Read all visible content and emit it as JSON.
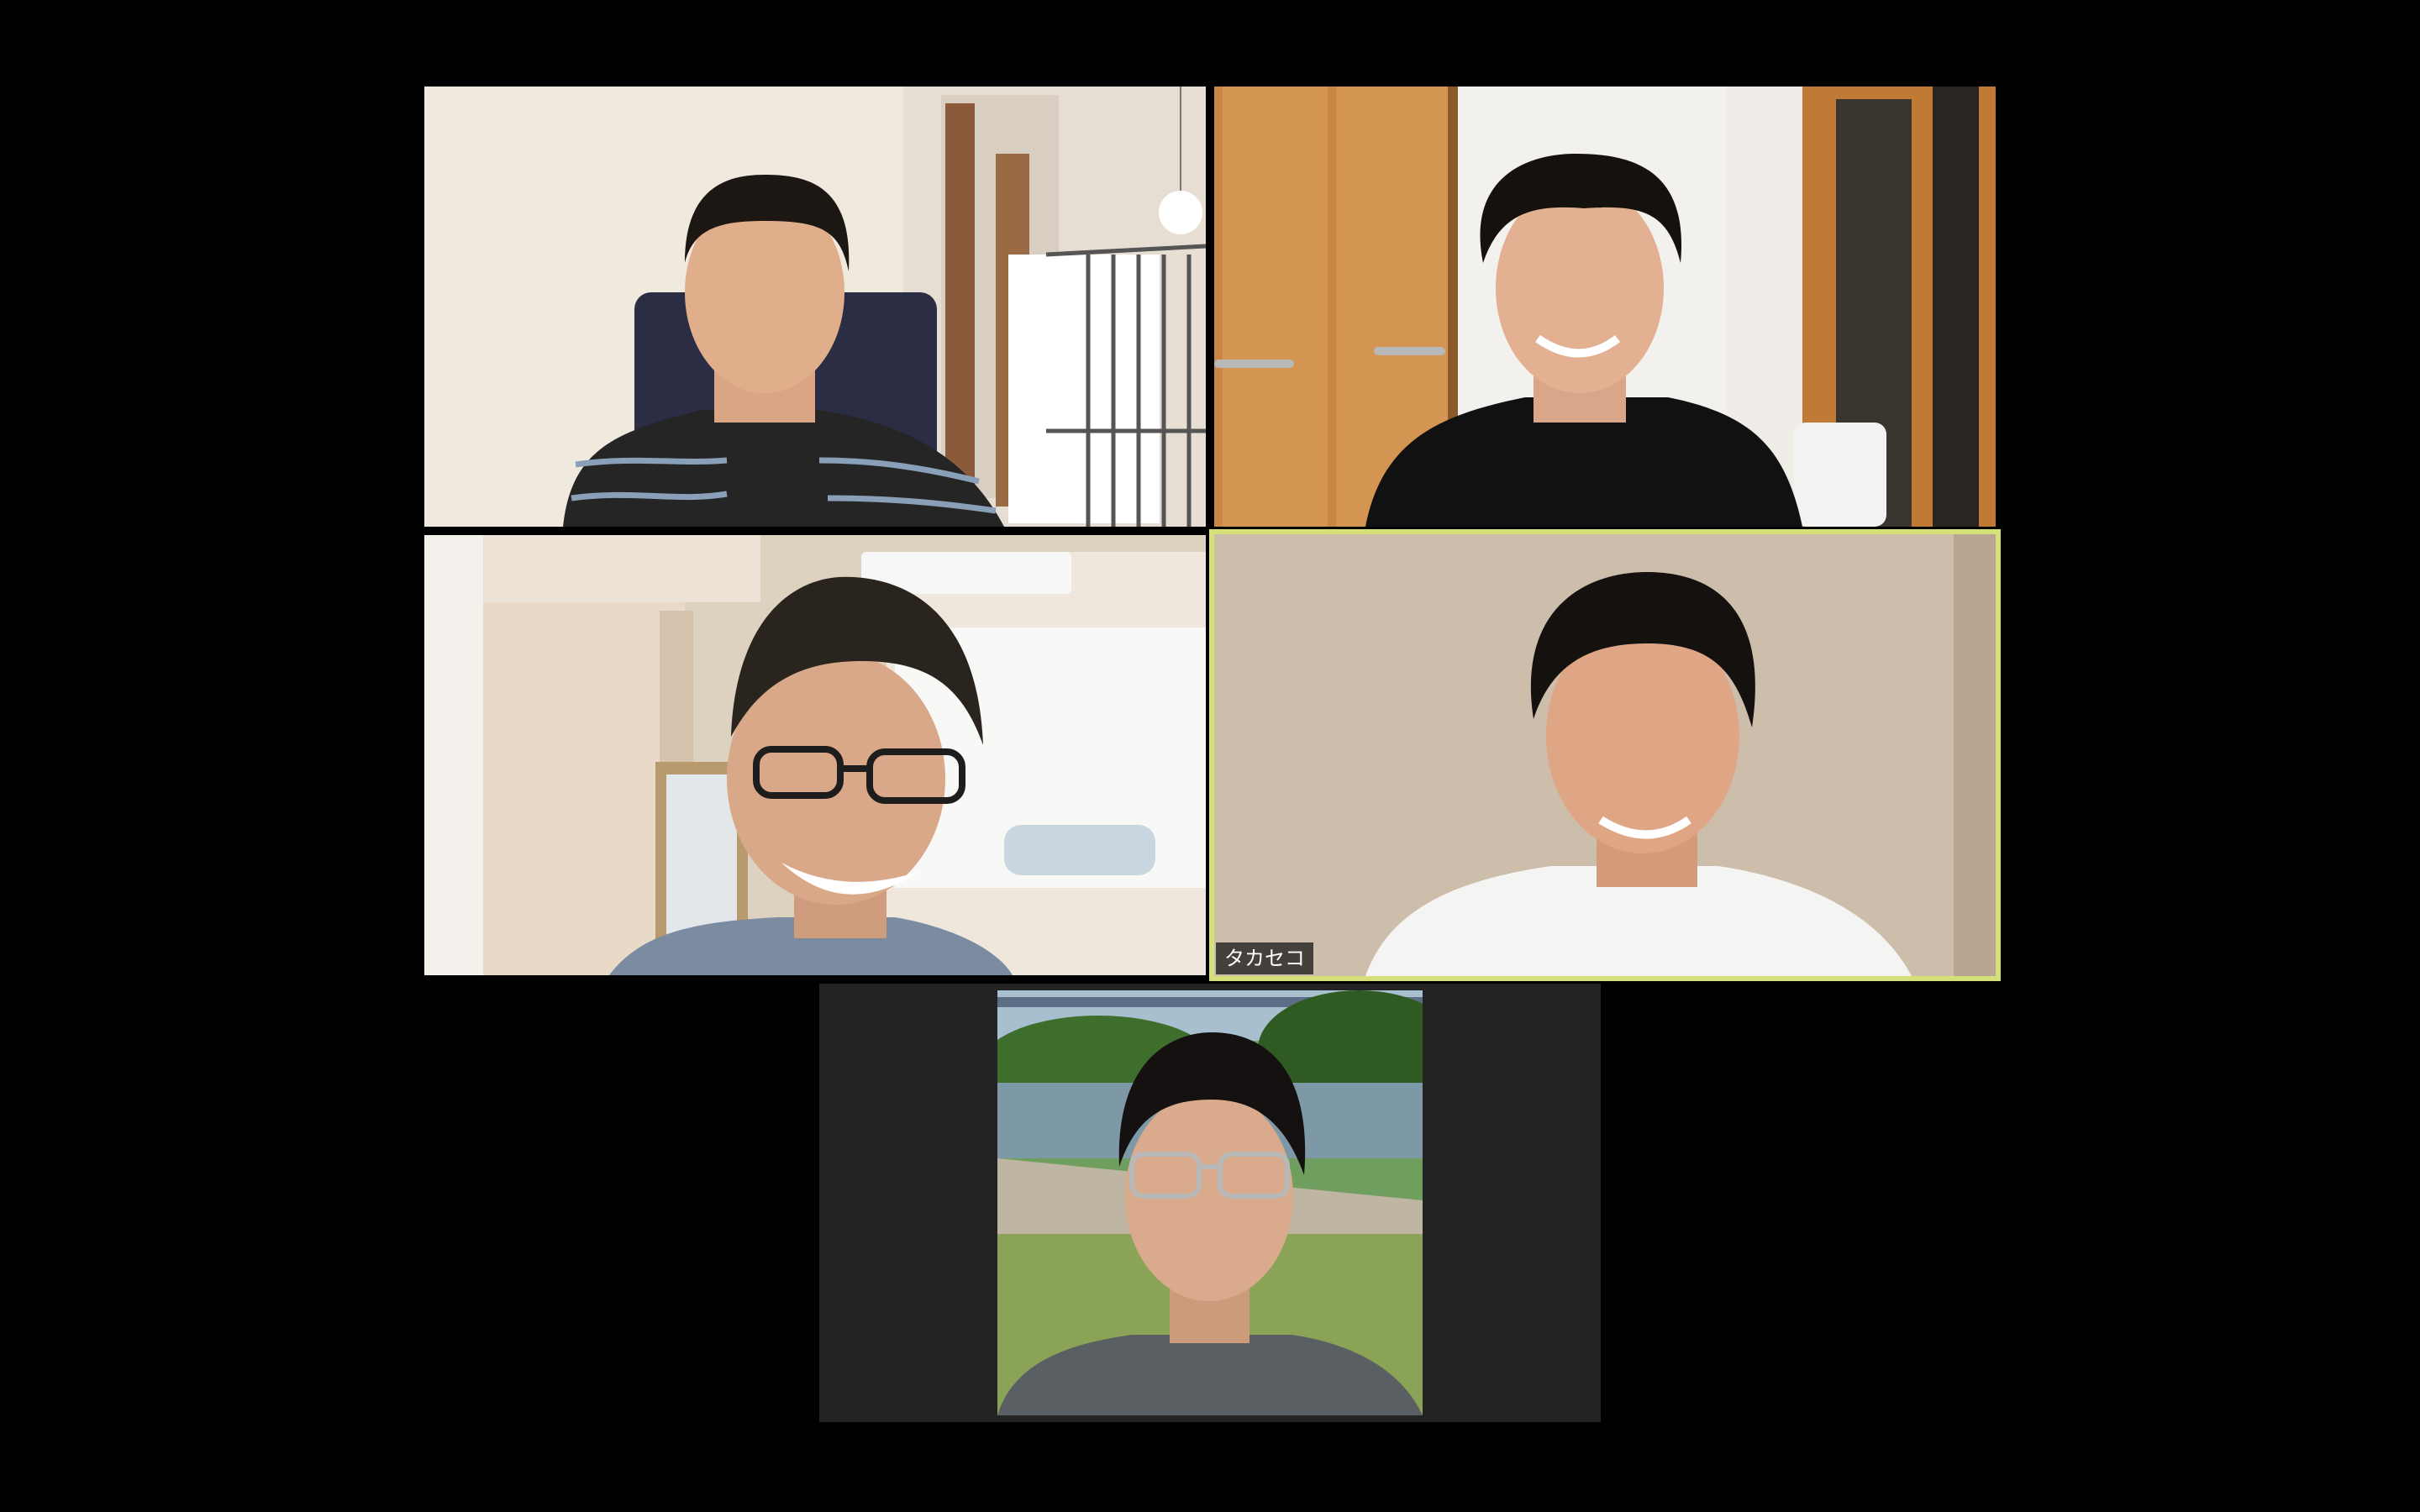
{
  "app": {
    "view": "gallery"
  },
  "participants": [
    {
      "display_name": "",
      "active_speaker": false
    },
    {
      "display_name": "",
      "active_speaker": false
    },
    {
      "display_name": "",
      "active_speaker": false
    },
    {
      "display_name": "タカセコ",
      "active_speaker": true
    },
    {
      "display_name": "",
      "active_speaker": false
    }
  ],
  "colors": {
    "background": "#000000",
    "active_speaker_border": "#d6e07a",
    "name_tag_bg": "#1e1e1e",
    "empty_tile_bg": "#232323"
  }
}
